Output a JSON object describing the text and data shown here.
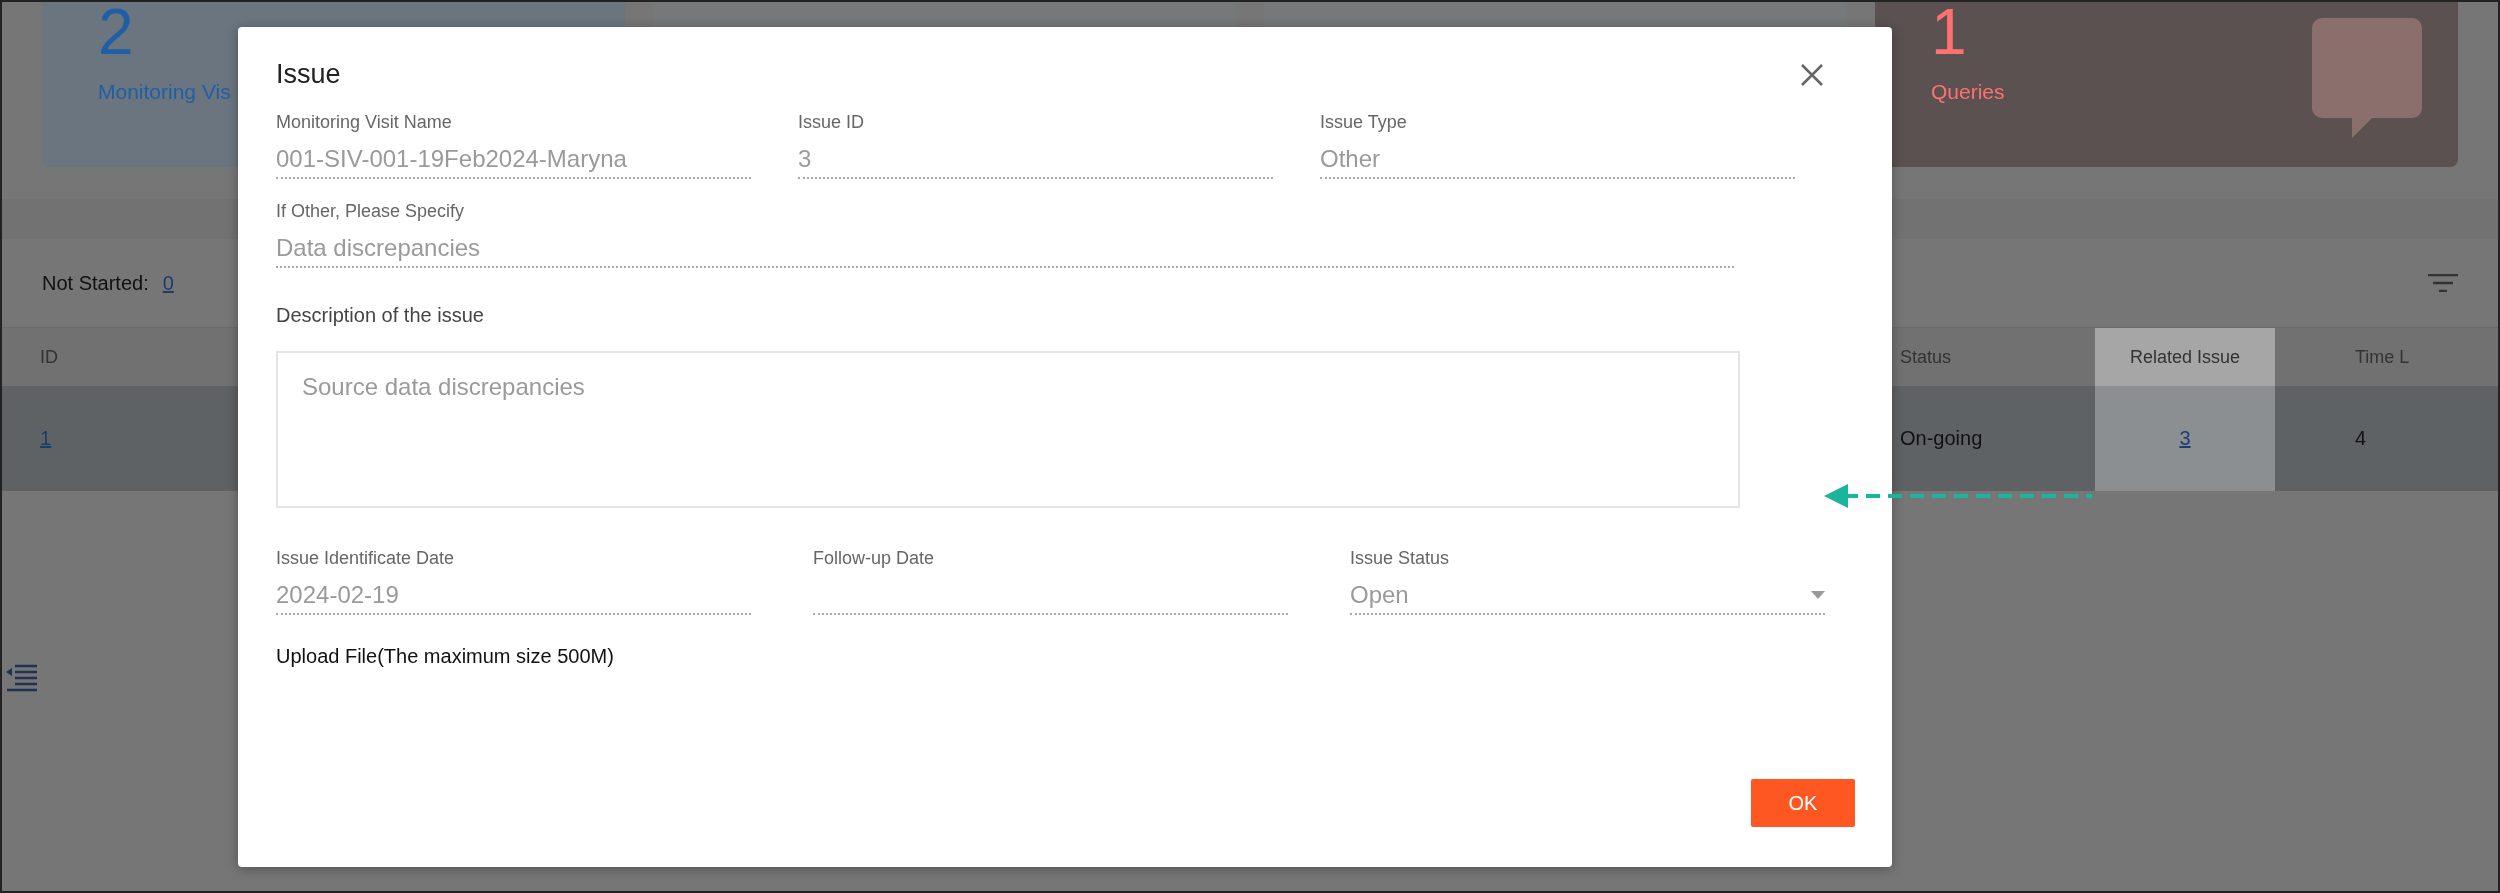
{
  "summary_cards": [
    {
      "value": "2",
      "label": "Monitoring Vis",
      "color": "#1f5fa6"
    },
    {
      "value": "1",
      "label": "Queries",
      "color": "#ff7070"
    }
  ],
  "status_counts": [
    {
      "label": "Not Started:",
      "value": "0"
    }
  ],
  "table": {
    "columns": [
      {
        "label": "ID",
        "highlighted": false
      },
      {
        "label": "Status",
        "highlighted": false
      },
      {
        "label": "Related Issue",
        "highlighted": true
      },
      {
        "label": "Time L",
        "highlighted": false
      }
    ],
    "rows": [
      {
        "selected": true,
        "cells": [
          {
            "kind": "link",
            "text": "1"
          },
          {
            "kind": "text",
            "text": "On-going"
          },
          {
            "kind": "link",
            "text": "3"
          },
          {
            "kind": "text",
            "text": "4"
          }
        ]
      }
    ]
  },
  "dialog": {
    "title": "Issue",
    "fields_top": [
      {
        "kind": "text",
        "label": "Monitoring Visit Name",
        "value": "001-SIV-001-19Feb2024-Maryna"
      },
      {
        "kind": "text",
        "label": "Issue ID",
        "value": "3"
      },
      {
        "kind": "text",
        "label": "Issue Type",
        "value": "Other"
      }
    ],
    "other_field": {
      "kind": "text",
      "label": "If Other, Please Specify",
      "value": "Data discrepancies"
    },
    "description": {
      "label": "Description of the issue",
      "value": "Source data discrepancies"
    },
    "fields_bottom": [
      {
        "kind": "text",
        "label": "Issue Identificate Date",
        "value": "2024-02-19"
      },
      {
        "kind": "text",
        "label": "Follow-up Date"
      },
      {
        "kind": "select",
        "label": "Issue Status",
        "value": "Open"
      }
    ],
    "upload_label": "Upload File(The maximum size 500M)",
    "ok_button": "OK"
  }
}
